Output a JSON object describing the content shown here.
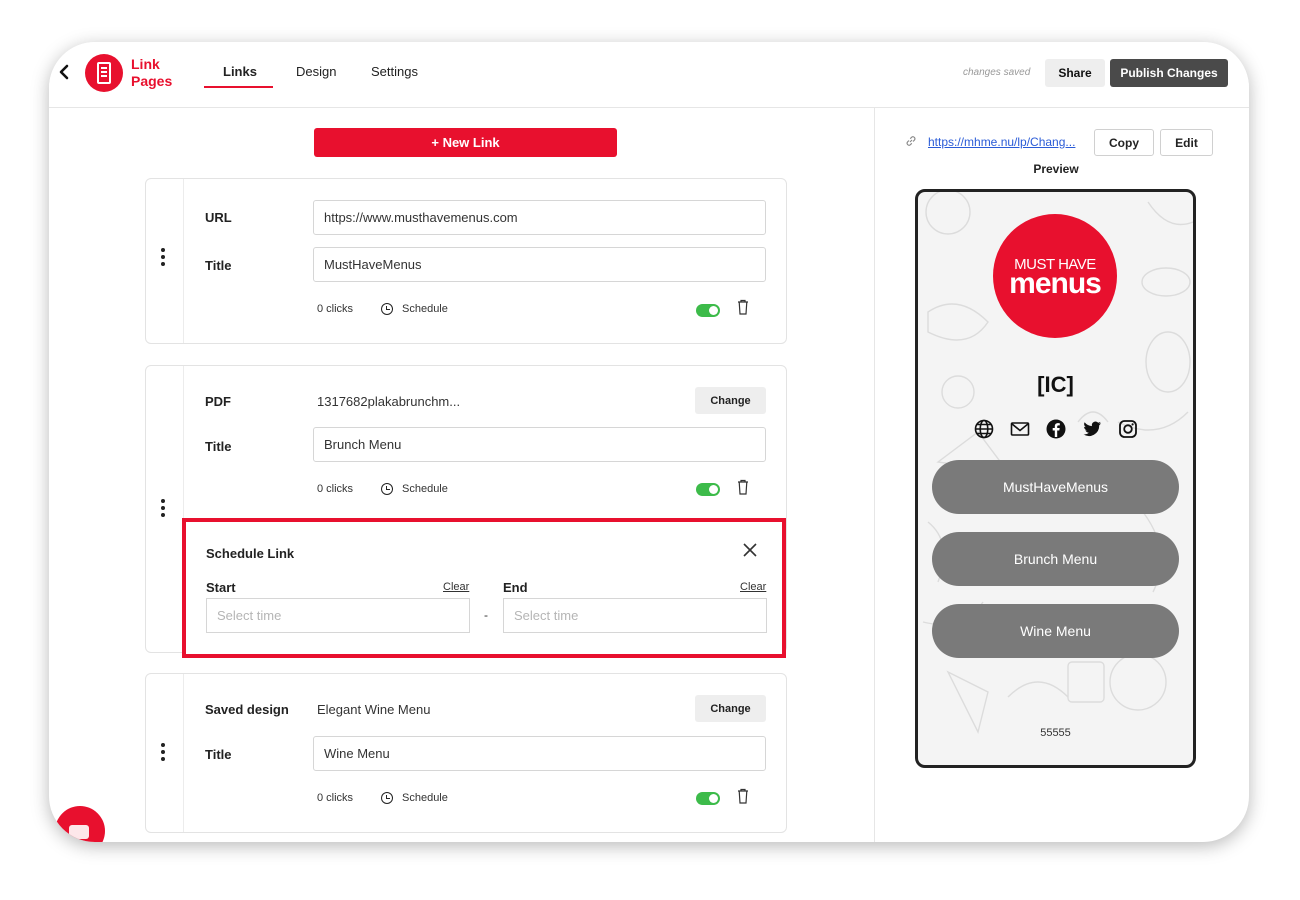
{
  "header": {
    "logo_line1": "Link",
    "logo_line2": "Pages",
    "tabs": [
      {
        "label": "Links"
      },
      {
        "label": "Design"
      },
      {
        "label": "Settings"
      }
    ],
    "saved_status": "changes saved",
    "share_label": "Share",
    "publish_label": "Publish Changes"
  },
  "editor": {
    "new_link_label": "+ New Link",
    "cards": [
      {
        "type_label": "URL",
        "type_value": "https://www.musthavemenus.com",
        "title_label": "Title",
        "title_value": "MustHaveMenus",
        "clicks": "0 clicks",
        "schedule": "Schedule"
      },
      {
        "type_label": "PDF",
        "type_value": "1317682plakabrunchm...",
        "change_label": "Change",
        "title_label": "Title",
        "title_value": "Brunch Menu",
        "clicks": "0 clicks",
        "schedule": "Schedule"
      },
      {
        "type_label": "Saved design",
        "type_value": "Elegant Wine Menu",
        "change_label": "Change",
        "title_label": "Title",
        "title_value": "Wine Menu",
        "clicks": "0 clicks",
        "schedule": "Schedule"
      }
    ],
    "schedule_box": {
      "title": "Schedule Link",
      "start_label": "Start",
      "end_label": "End",
      "clear_label": "Clear",
      "placeholder": "Select time",
      "separator": "-"
    }
  },
  "preview": {
    "url": "https://mhme.nu/lp/Chang...",
    "copy_label": "Copy",
    "edit_label": "Edit",
    "preview_label": "Preview",
    "brand_line1": "MUST HAVE",
    "brand_line2": "menus",
    "profile_name": "[IC]",
    "buttons": [
      {
        "label": "MustHaveMenus"
      },
      {
        "label": "Brunch Menu"
      },
      {
        "label": "Wine Menu"
      }
    ],
    "footer": "55555",
    "social_icons": [
      "globe-icon",
      "mail-icon",
      "facebook-icon",
      "twitter-icon",
      "instagram-icon"
    ]
  },
  "colors": {
    "brand_red": "#e8102e",
    "toggle_green": "#3dbb4a",
    "preview_button": "#7a7a7a",
    "publish_dark": "#4a4a4a"
  }
}
